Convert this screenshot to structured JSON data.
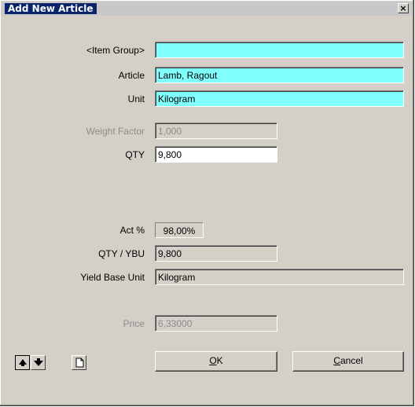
{
  "window": {
    "title": "Add New Article",
    "close_glyph": "×"
  },
  "form": {
    "item_group": {
      "label": "<Item Group>",
      "value": ""
    },
    "article": {
      "label": "Article",
      "value": "Lamb, Ragout"
    },
    "unit": {
      "label": "Unit",
      "value": "Kilogram"
    },
    "weight_factor": {
      "label": "Weight Factor",
      "value": "1,000"
    },
    "qty": {
      "label": "QTY",
      "value": "9,800"
    },
    "act_pct": {
      "label": "Act %",
      "value": "98,00%"
    },
    "qty_ybu": {
      "label": "QTY / YBU",
      "value": "9,800"
    },
    "yield_base_unit": {
      "label": "Yield Base Unit",
      "value": "Kilogram"
    },
    "price": {
      "label": "Price",
      "value": "6,33000"
    }
  },
  "buttons": {
    "ok": {
      "mnemonic": "O",
      "rest": "K"
    },
    "cancel": {
      "mnemonic": "C",
      "rest": "ancel"
    }
  },
  "icons": {
    "move_up": "arrow-up-icon",
    "move_down": "arrow-down-icon",
    "new": "new-document-icon"
  },
  "colors": {
    "titlebar_bg": "#0a246a",
    "required_field": "#80ffff",
    "dialog_face": "#d4d0c8",
    "disabled_text": "#8c8c8c"
  }
}
